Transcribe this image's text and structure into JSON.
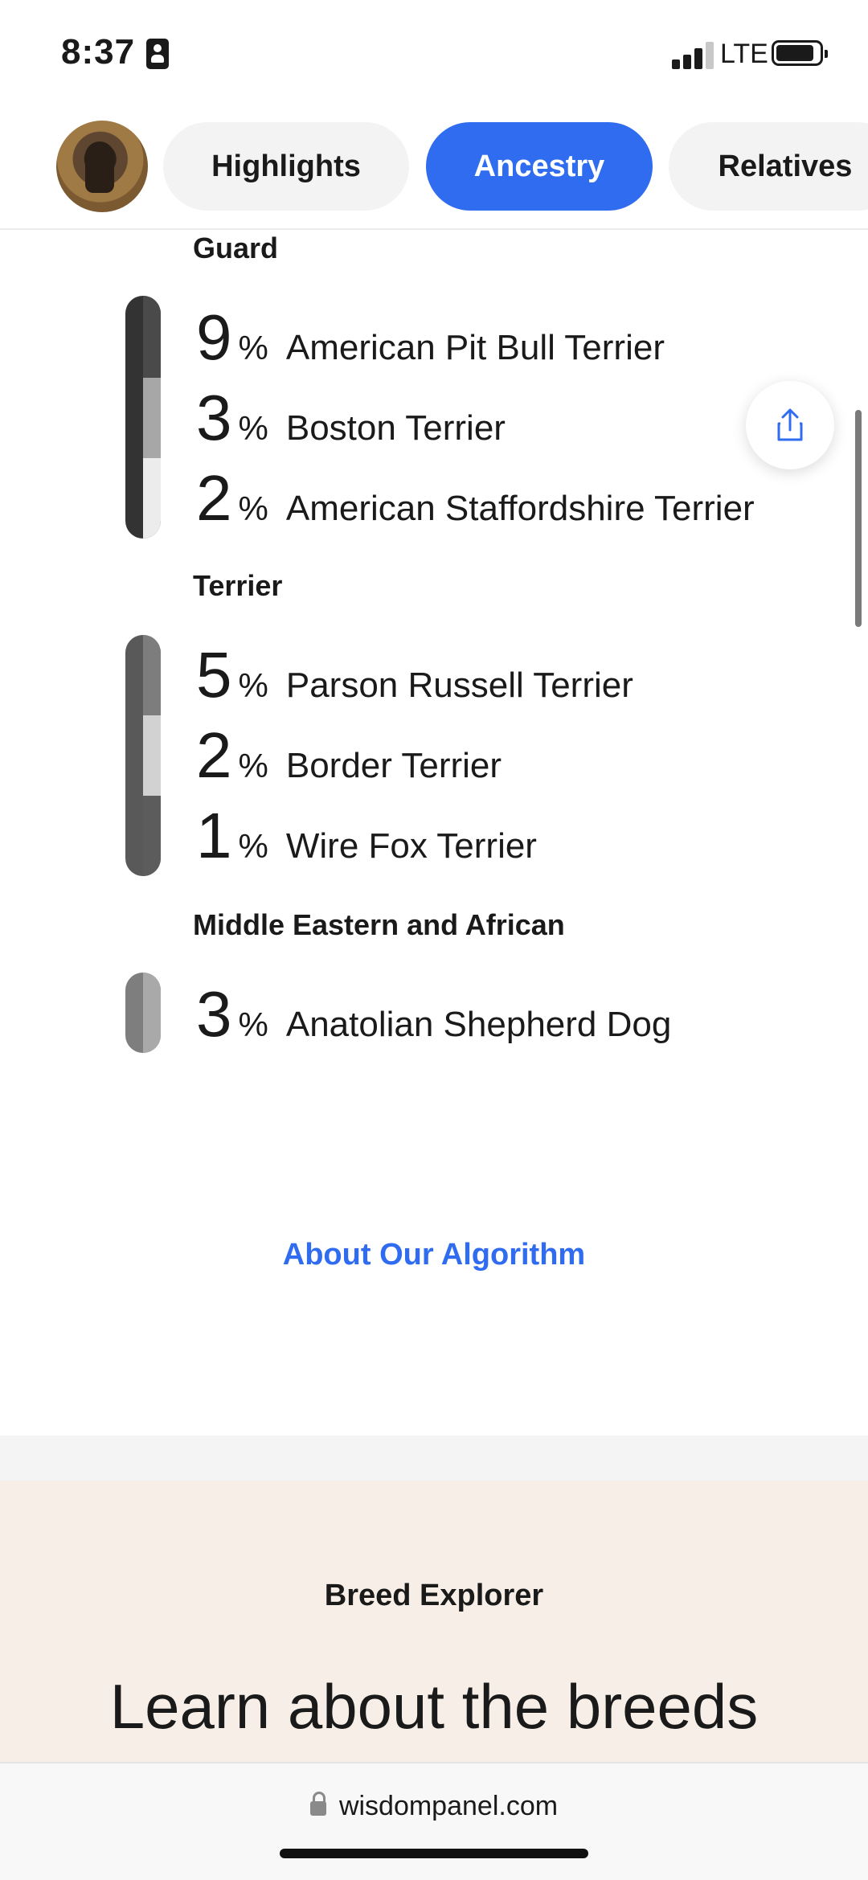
{
  "status": {
    "time": "8:37",
    "network": "LTE"
  },
  "tabs": [
    {
      "label": "Highlights",
      "active": false
    },
    {
      "label": "Ancestry",
      "active": true
    },
    {
      "label": "Relatives",
      "active": false
    }
  ],
  "groups": [
    {
      "title": "Guard",
      "breeds": [
        {
          "percent": "9",
          "name": "American Pit Bull Terrier"
        },
        {
          "percent": "3",
          "name": "Boston Terrier"
        },
        {
          "percent": "2",
          "name": "American Staffordshire Terrier"
        }
      ]
    },
    {
      "title": "Terrier",
      "breeds": [
        {
          "percent": "5",
          "name": "Parson Russell Terrier"
        },
        {
          "percent": "2",
          "name": "Border Terrier"
        },
        {
          "percent": "1",
          "name": "Wire Fox Terrier"
        }
      ]
    },
    {
      "title": "Middle Eastern and African",
      "breeds": [
        {
          "percent": "3",
          "name": "Anatolian Shepherd Dog"
        }
      ]
    }
  ],
  "percent_symbol": "%",
  "about_link": "About Our Algorithm",
  "explorer": {
    "label": "Breed Explorer",
    "heading": "Learn about the breeds"
  },
  "browser": {
    "url": "wisdompanel.com"
  },
  "colors": {
    "accent": "#2f6cf0",
    "explorer_bg": "#f7efe7"
  }
}
